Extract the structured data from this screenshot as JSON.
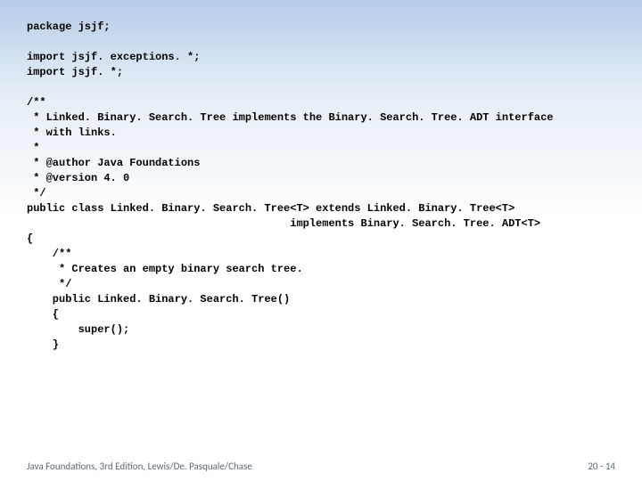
{
  "code": {
    "l01": "package jsjf;",
    "l02": "",
    "l03": "import jsjf. exceptions. *;",
    "l04": "import jsjf. *;",
    "l05": "",
    "l06": "/**",
    "l07": " * Linked. Binary. Search. Tree implements the Binary. Search. Tree. ADT interface",
    "l08": " * with links.",
    "l09": " *",
    "l10": " * @author Java Foundations",
    "l11": " * @version 4. 0",
    "l12": " */",
    "l13": "public class Linked. Binary. Search. Tree<T> extends Linked. Binary. Tree<T>",
    "l14": "                                         implements Binary. Search. Tree. ADT<T>",
    "l15": "{",
    "l16": "    /**",
    "l17": "     * Creates an empty binary search tree.",
    "l18": "     */",
    "l19": "    public Linked. Binary. Search. Tree()",
    "l20": "    {",
    "l21": "        super();",
    "l22": "    }"
  },
  "footer": {
    "left": "Java Foundations, 3rd Edition, Lewis/De. Pasquale/Chase",
    "right": "20 - 14"
  }
}
